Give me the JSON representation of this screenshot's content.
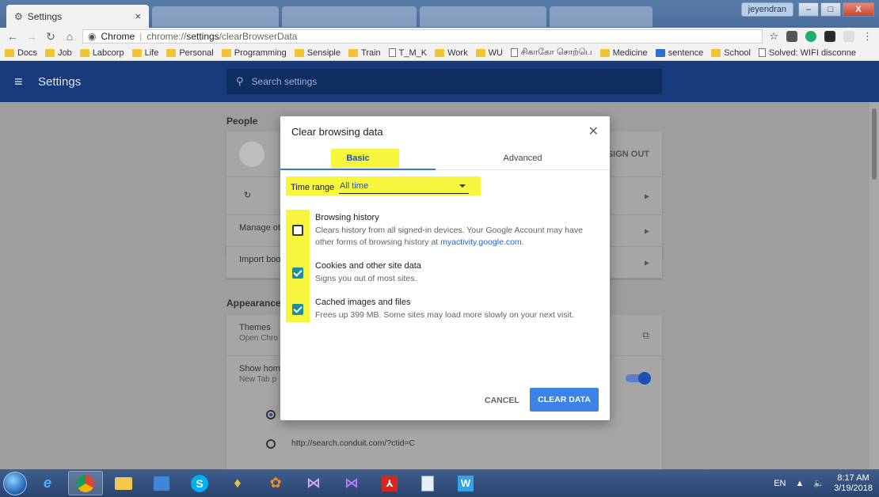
{
  "window": {
    "tab_title": "Settings",
    "user_chip": "jeyendran",
    "min_label": "–",
    "max_label": "□",
    "close_label": "X"
  },
  "toolbar": {
    "site_label": "Chrome",
    "url_scheme": "chrome://",
    "url_host": "settings",
    "url_path": "/clearBrowserData"
  },
  "bookmarks": [
    {
      "label": "Docs",
      "icon": "folder"
    },
    {
      "label": "Job",
      "icon": "folder"
    },
    {
      "label": "Labcorp",
      "icon": "folder"
    },
    {
      "label": "Life",
      "icon": "folder"
    },
    {
      "label": "Personal",
      "icon": "folder"
    },
    {
      "label": "Programming",
      "icon": "folder"
    },
    {
      "label": "Sensiple",
      "icon": "folder"
    },
    {
      "label": "Train",
      "icon": "folder"
    },
    {
      "label": "T_M_K",
      "icon": "page"
    },
    {
      "label": "Work",
      "icon": "folder"
    },
    {
      "label": "WU",
      "icon": "folder"
    },
    {
      "label": "சிகாகோ சொற்பெ",
      "icon": "page"
    },
    {
      "label": "Medicine",
      "icon": "folder"
    },
    {
      "label": "sentence",
      "icon": "yd"
    },
    {
      "label": "School",
      "icon": "folder"
    },
    {
      "label": "Solved: WIFI disconne",
      "icon": "page"
    }
  ],
  "settings": {
    "title": "Settings",
    "search_placeholder": "Search settings",
    "people_label": "People",
    "sign_out": "SIGN OUT",
    "row_manage": "Manage ot",
    "row_import": "Import boo",
    "appearance_label": "Appearance",
    "themes": "Themes",
    "themes_sub": "Open Chro",
    "show_home": "Show home",
    "show_home_sub": "New Tab p",
    "conduit_url": "http://search.conduit.com/?ctid=C"
  },
  "dialog": {
    "title": "Clear browsing data",
    "tab_basic": "Basic",
    "tab_advanced": "Advanced",
    "time_range_label": "Time range",
    "time_range_value": "All time",
    "options": [
      {
        "title": "Browsing history",
        "desc": "Clears history from all signed-in devices. Your Google Account may have other forms of browsing history at",
        "link": "myactivity.google.com",
        "checked": false
      },
      {
        "title": "Cookies and other site data",
        "desc": "Signs you out of most sites.",
        "checked": true
      },
      {
        "title": "Cached images and files",
        "desc": "Frees up 399 MB. Some sites may load more slowly on your next visit.",
        "checked": true
      }
    ],
    "cancel_label": "CANCEL",
    "clear_label": "CLEAR DATA"
  },
  "taskbar": {
    "lang": "EN",
    "time": "8:17 AM",
    "date": "3/19/2018"
  },
  "colors": {
    "header": "#173a7a",
    "highlight": "#f6f63c",
    "primary": "#3d82e6",
    "checkbox": "#1e8e9b"
  }
}
